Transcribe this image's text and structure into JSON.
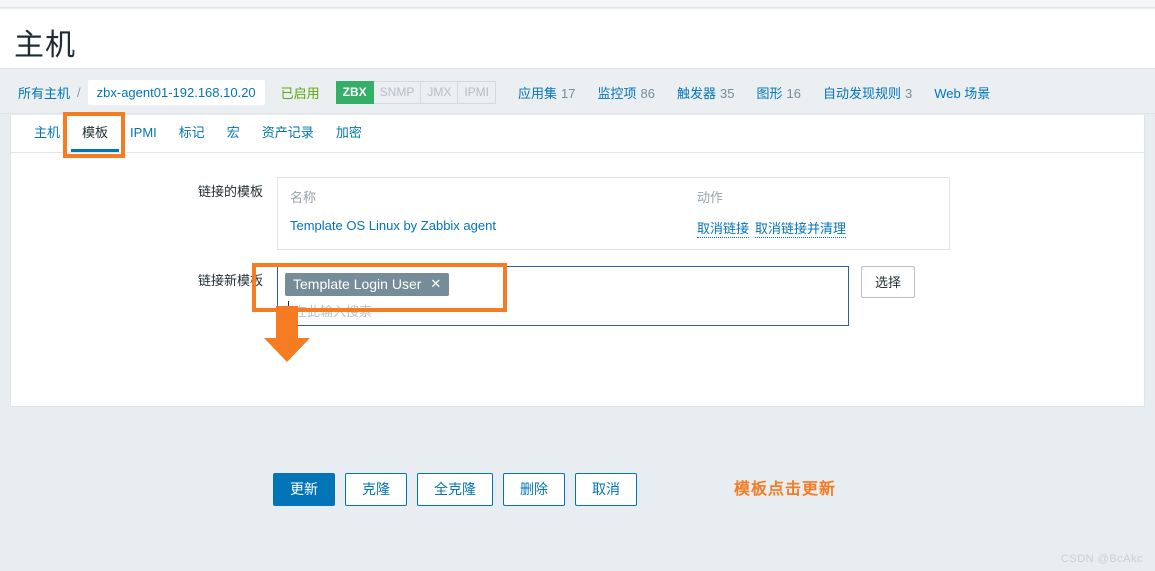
{
  "page": {
    "title": "主机",
    "watermark": "CSDN @BcAkc"
  },
  "breadcrumb": {
    "all_hosts_label": "所有主机",
    "separator": "/",
    "current_host": "zbx-agent01-192.168.10.20",
    "status": "已启用",
    "interfaces": [
      {
        "label": "ZBX",
        "active": true
      },
      {
        "label": "SNMP",
        "active": false
      },
      {
        "label": "JMX",
        "active": false
      },
      {
        "label": "IPMI",
        "active": false
      }
    ],
    "counts": [
      {
        "label": "应用集",
        "value": "17"
      },
      {
        "label": "监控项",
        "value": "86"
      },
      {
        "label": "触发器",
        "value": "35"
      },
      {
        "label": "图形",
        "value": "16"
      },
      {
        "label": "自动发现规则",
        "value": "3"
      },
      {
        "label": "Web 场景",
        "value": ""
      }
    ]
  },
  "tabs": [
    {
      "label": "主机",
      "active": false
    },
    {
      "label": "模板",
      "active": true
    },
    {
      "label": "IPMI",
      "active": false
    },
    {
      "label": "标记",
      "active": false
    },
    {
      "label": "宏",
      "active": false
    },
    {
      "label": "资产记录",
      "active": false
    },
    {
      "label": "加密",
      "active": false
    }
  ],
  "form": {
    "linked_templates": {
      "label": "链接的模板",
      "header_name": "名称",
      "header_action": "动作",
      "rows": [
        {
          "name": "Template OS Linux by Zabbix agent",
          "actions": [
            "取消链接",
            "取消链接并清理"
          ]
        }
      ]
    },
    "link_new_template": {
      "label": "链接新模板",
      "chips": [
        {
          "text": "Template Login User",
          "remove_icon": "✕"
        }
      ],
      "placeholder": "在此输入搜索",
      "select_button": "选择"
    }
  },
  "buttons": [
    {
      "label": "更新",
      "style": "primary"
    },
    {
      "label": "克隆",
      "style": "secondary"
    },
    {
      "label": "全克隆",
      "style": "secondary"
    },
    {
      "label": "删除",
      "style": "secondary"
    },
    {
      "label": "取消",
      "style": "secondary"
    }
  ],
  "annotations": {
    "note_text": "模板点击更新",
    "accent_color": "#f47c24"
  },
  "colors": {
    "link": "#0275b8",
    "enabled_green": "#59a80f",
    "zbx_green": "#34af67",
    "chip_gray": "#768d99",
    "annotation_orange": "#f47c24"
  }
}
